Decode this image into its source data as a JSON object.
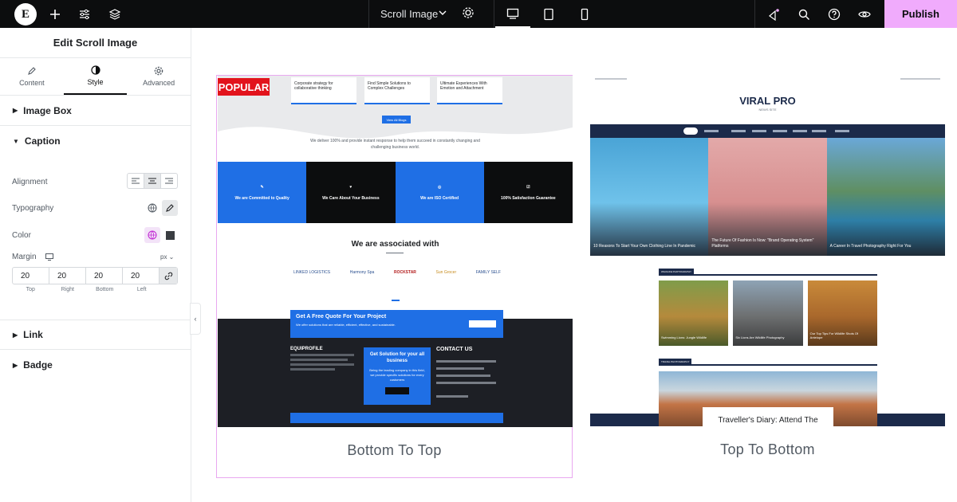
{
  "topbar": {
    "logo": "E",
    "document_title": "Scroll Image",
    "publish_label": "Publish",
    "colors": {
      "background": "#0c0d0e",
      "publish": "#f0abfc"
    }
  },
  "panel": {
    "title": "Edit Scroll Image",
    "tabs": [
      {
        "label": "Content",
        "icon": "pencil-icon"
      },
      {
        "label": "Style",
        "icon": "contrast-icon",
        "active": true
      },
      {
        "label": "Advanced",
        "icon": "gear-icon"
      }
    ],
    "sections": {
      "image_box": "Image Box",
      "caption": "Caption",
      "link": "Link",
      "badge": "Badge"
    },
    "controls": {
      "alignment": "Alignment",
      "typography": "Typography",
      "color": "Color",
      "margin": "Margin",
      "unit": "px",
      "margin_values": {
        "top": "20",
        "right": "20",
        "bottom": "20",
        "left": "20"
      },
      "margin_labels": {
        "top": "Top",
        "right": "Right",
        "bottom": "Bottom",
        "left": "Left"
      }
    }
  },
  "canvas": {
    "cards": [
      {
        "caption": "Bottom To Top",
        "badge": "POPULAR",
        "mini_cards": [
          "Corporate strategy for collaborative thinking",
          "Find Simple Solutions to Complex Challenges",
          "Ultimate Experiences With Emotion and Attachment"
        ],
        "button": "View All Blogs",
        "intro": "We deliver 100% and provide instant response to help them succeed in constantly changing and challenging business world.",
        "tiles": [
          "We are Committed to Quality",
          "We Care About Your Business",
          "We are ISO Certified",
          "100% Satisfaction Guarantee"
        ],
        "associated_heading": "We are associated with",
        "partner_logos": [
          "LINKED LOGISTICS",
          "Harmony Spa",
          "ROCKSTAR",
          "Sun Grocer",
          "FAMILY SELF"
        ],
        "quote_title": "Get A Free Quote For Your Project",
        "quote_sub": "We offer solutions that are reliable, efficient, effective, and sustainable.",
        "footer_brand": "EQUIPROFILE",
        "solution_title": "Get Solution for your all business",
        "solution_text": "Being the leading company in this field, we provide specific solutions for every customers",
        "contact_title": "CONTACT US"
      },
      {
        "caption": "Top To Bottom",
        "logo": "VIRAL PRO",
        "logo_sub": "NEWS SITE",
        "hero_captions": [
          "10 Reasons To Start Your Own Clothing Line In Pandemic",
          "The Future Of Fashion Is Now: \"Brand Operating System\" Platforms",
          "A Career In Travel Photography Right For You"
        ],
        "section_one": "WILDLIFE PHOTOGRAPHY",
        "grid_captions": [
          "Swimming Lions: Jungle Wildlife",
          "Six Lions Are Wildlife Photography",
          "Our Top Tips For Wildlife Shots Of Antelope"
        ],
        "section_two": "TRAVEL PHOTOGRAPHY",
        "bottom_headline": "Traveller's Diary: Attend The"
      }
    ]
  }
}
